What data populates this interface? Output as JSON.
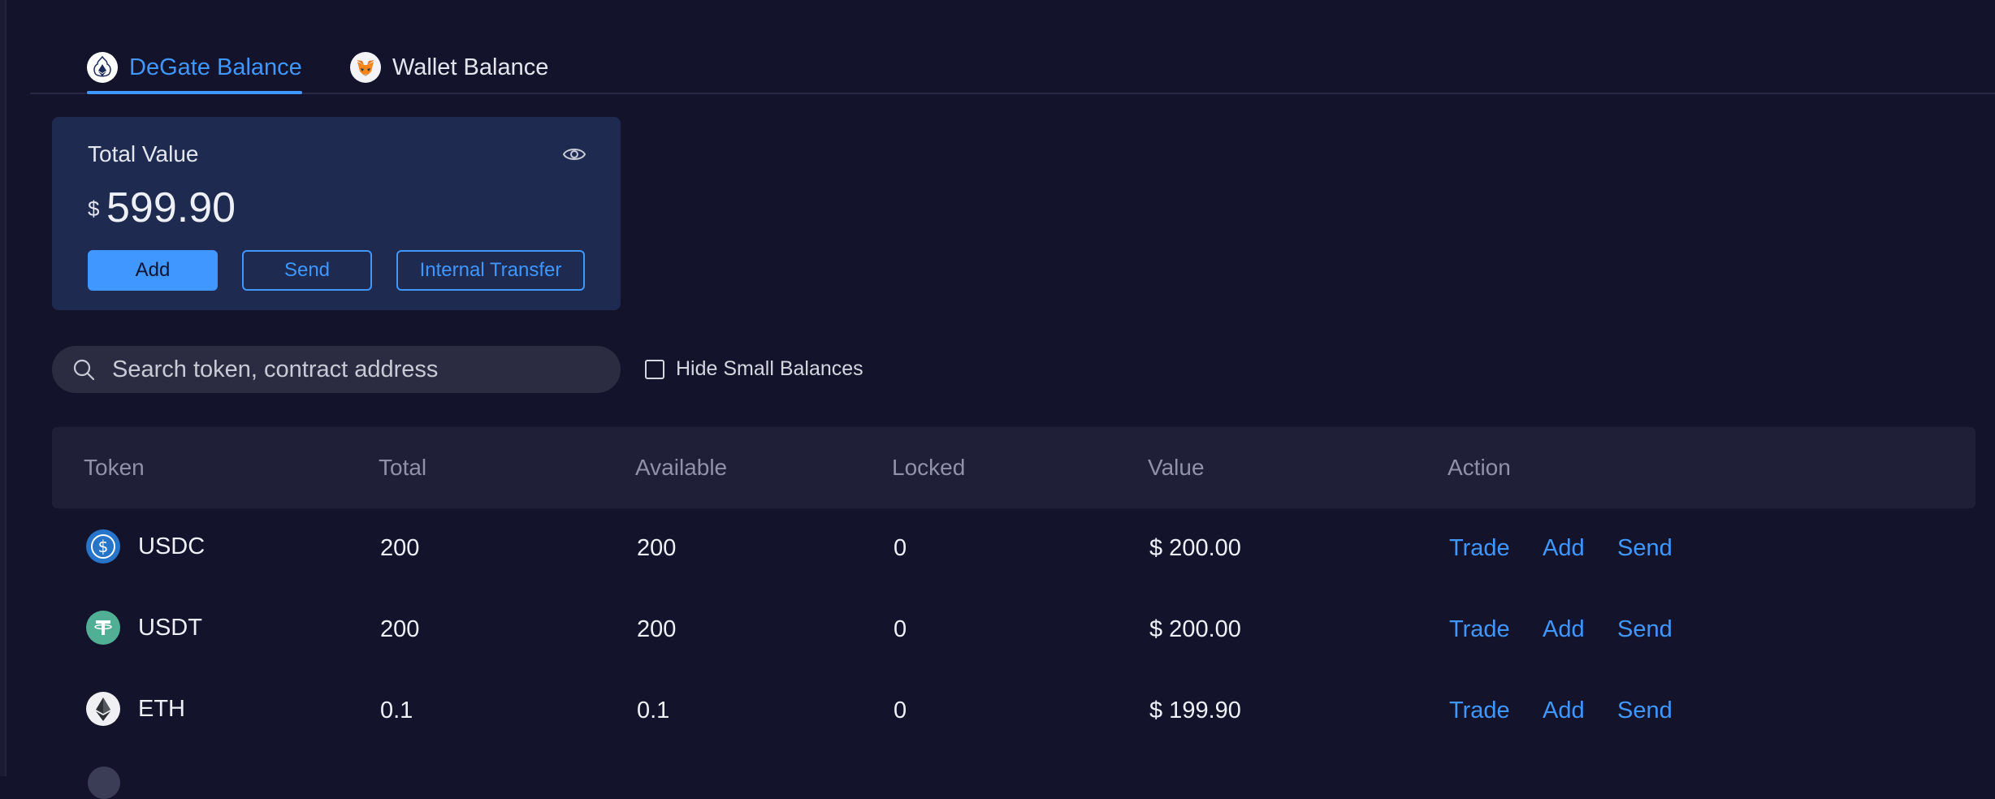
{
  "tabs": [
    {
      "label": "DeGate Balance",
      "icon": "degate-logo-icon",
      "active": true
    },
    {
      "label": "Wallet Balance",
      "icon": "metamask-fox-icon",
      "active": false
    }
  ],
  "balance_card": {
    "title": "Total Value",
    "currency_symbol": "$",
    "amount": "599.90",
    "buttons": {
      "add": "Add",
      "send": "Send",
      "internal_transfer": "Internal Transfer"
    }
  },
  "search": {
    "placeholder": "Search token, contract address"
  },
  "hide_small_balances": {
    "label": "Hide Small Balances",
    "checked": false
  },
  "table": {
    "headers": [
      "Token",
      "Total",
      "Available",
      "Locked",
      "Value",
      "Action"
    ],
    "rows": [
      {
        "token": "USDC",
        "icon": "usdc-icon",
        "total": "200",
        "available": "200",
        "locked": "0",
        "value": "$ 200.00",
        "actions": [
          "Trade",
          "Add",
          "Send"
        ]
      },
      {
        "token": "USDT",
        "icon": "usdt-icon",
        "total": "200",
        "available": "200",
        "locked": "0",
        "value": "$ 200.00",
        "actions": [
          "Trade",
          "Add",
          "Send"
        ]
      },
      {
        "token": "ETH",
        "icon": "eth-icon",
        "total": "0.1",
        "available": "0.1",
        "locked": "0",
        "value": "$ 199.90",
        "actions": [
          "Trade",
          "Add",
          "Send"
        ]
      }
    ]
  },
  "colors": {
    "background": "#13132b",
    "accent": "#3f97ff",
    "card": "#1e2a4f",
    "header_text": "#8f92a8"
  }
}
